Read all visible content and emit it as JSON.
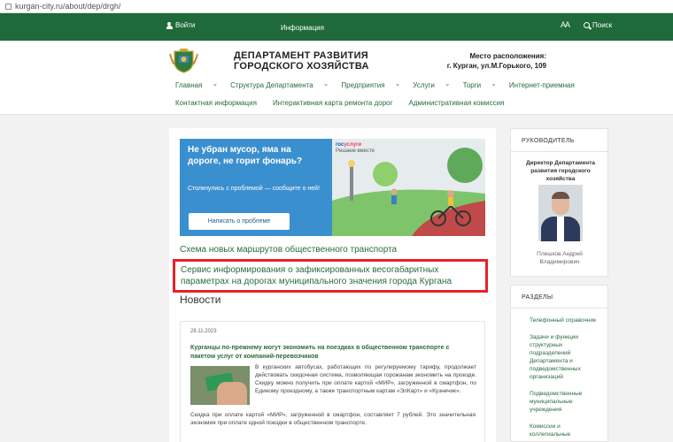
{
  "browser": {
    "url": "kurgan-city.ru/about/dep/drgh/"
  },
  "topbar": {
    "login": "Войти",
    "info": "Информация",
    "font_size": "AA",
    "search": "Поиск"
  },
  "header": {
    "title_line1": "ДЕПАРТАМЕНТ РАЗВИТИЯ",
    "title_line2": "ГОРОДСКОГО ХОЗЯЙСТВА",
    "location_label": "Место расположения:",
    "location_value": "г. Курган, ул.М.Горького, 109"
  },
  "nav": {
    "row1": [
      "Главная",
      "Структура Департамента",
      "Предприятия",
      "Услуги",
      "Торги",
      "Интернет-приемная"
    ],
    "row2": [
      "Контактная информация",
      "Интерактивная карта ремонта дорог",
      "Административная комиссия"
    ]
  },
  "banner": {
    "title": "Не убран мусор, яма на дороге, не горит фонарь?",
    "subtitle": "Столкнулись с проблемой — сообщите о ней!",
    "button": "Написать о проблеме",
    "gos1": "гос",
    "gos2": "услуги",
    "gos3": "Решаем вместе"
  },
  "links": {
    "routes": "Схема новых маршрутов общественного транспорта",
    "weight_service": "Сервис информирования о зафиксированных весогабаритных параметрах на дорогах муниципального значения города Кургана"
  },
  "news": {
    "heading": "Новости",
    "date": "28.11.2023",
    "title": "Курганцы по-прежнему могут экономить на поездках в общественном транспорте с пакетом услуг от компаний-перевозчиков",
    "text1": "В курганских автобусах, работающих по регулируемому тарифу, продолжает действовать скидочная система, позволяющая горожанам экономить на проезде. Скидку можно получить при оплате картой «МИР», загруженной в смартфон, по Единому проездному, а также транспортным картам «ЭлКарт» и «Кузнечик».",
    "text2": "Скидка при оплате картой «МИР», загруженной в смартфон, составляет 7 рублей. Это значительная экономия при оплате одной поездки в общественном транспорте."
  },
  "sidebar": {
    "head_title": "РУКОВОДИТЕЛЬ",
    "director_role": "Директор Департамента развития городского хозяйства",
    "director_name": "Плешков Андрей Владимирович",
    "sections_title": "РАЗДЕЛЫ",
    "sections": [
      "Телефонный справочник",
      "Задачи и функции структурных подразделений Департамента и подведомственных организаций",
      "Подведомственные муниципальные учреждения",
      "Комиссии и коллегиальные"
    ]
  },
  "colors": {
    "brand_green": "#1f6a3a",
    "link_green": "#2a6b3d",
    "highlight_red": "#e8202a",
    "banner_blue": "#3a8fcf"
  }
}
